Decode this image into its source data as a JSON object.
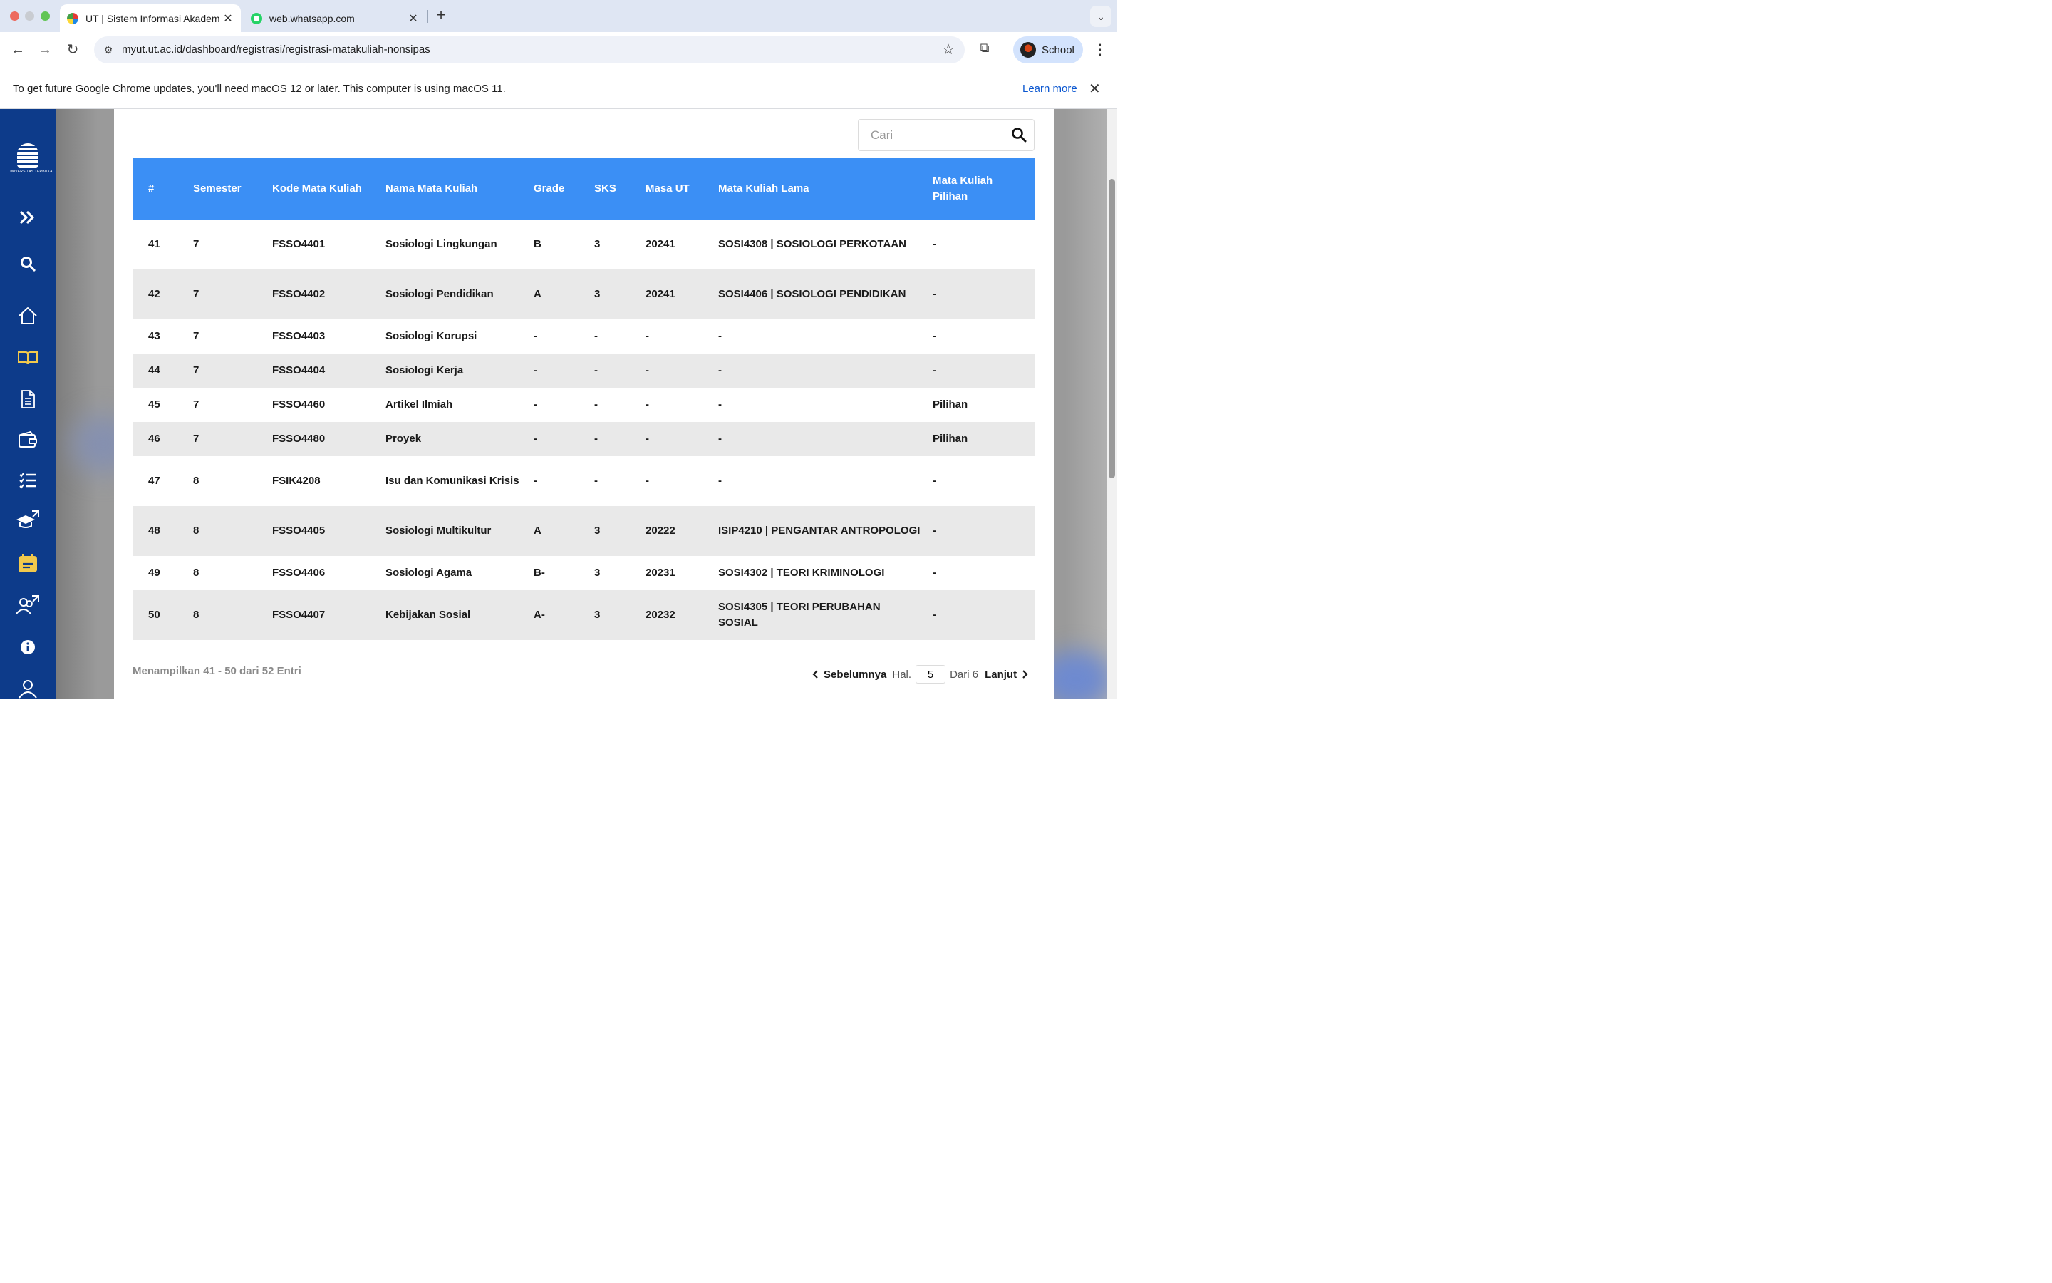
{
  "browser": {
    "tabs": [
      {
        "title": "UT | Sistem Informasi Akadem",
        "active": true
      },
      {
        "title": "web.whatsapp.com",
        "active": false
      }
    ],
    "url": "myut.ut.ac.id/dashboard/registrasi/registrasi-matakuliah-nonsipas",
    "profile_name": "School"
  },
  "infobar": {
    "message": "To get future Google Chrome updates, you'll need macOS 12 or later. This computer is using macOS 11.",
    "learn_more": "Learn more"
  },
  "sidebar": {
    "logo_text": "UNIVERSITAS TERBUKA",
    "icons": [
      "expand-icon",
      "search-icon",
      "home-icon",
      "book-icon",
      "document-icon",
      "wallet-icon",
      "checklist-icon",
      "graduation-external-icon",
      "calendar-icon",
      "users-external-icon",
      "info-icon",
      "user-icon"
    ]
  },
  "search": {
    "placeholder": "Cari",
    "value": ""
  },
  "table": {
    "headers": [
      "#",
      "Semester",
      "Kode Mata Kuliah",
      "Nama Mata Kuliah",
      "Grade",
      "SKS",
      "Masa UT",
      "Mata Kuliah Lama",
      "Mata Kuliah Pilihan"
    ],
    "rows": [
      {
        "no": "41",
        "semester": "7",
        "kode": "FSSO4401",
        "nama": "Sosiologi Lingkungan",
        "grade": "B",
        "sks": "3",
        "masa": "20241",
        "lama": "SOSI4308 | SOSIOLOGI PERKOTAAN",
        "pilihan": "-"
      },
      {
        "no": "42",
        "semester": "7",
        "kode": "FSSO4402",
        "nama": "Sosiologi Pendidikan",
        "grade": "A",
        "sks": "3",
        "masa": "20241",
        "lama": "SOSI4406 | SOSIOLOGI PENDIDIKAN",
        "pilihan": "-"
      },
      {
        "no": "43",
        "semester": "7",
        "kode": "FSSO4403",
        "nama": "Sosiologi Korupsi",
        "grade": "-",
        "sks": "-",
        "masa": "-",
        "lama": "-",
        "pilihan": "-"
      },
      {
        "no": "44",
        "semester": "7",
        "kode": "FSSO4404",
        "nama": "Sosiologi Kerja",
        "grade": "-",
        "sks": "-",
        "masa": "-",
        "lama": "-",
        "pilihan": "-"
      },
      {
        "no": "45",
        "semester": "7",
        "kode": "FSSO4460",
        "nama": "Artikel Ilmiah",
        "grade": "-",
        "sks": "-",
        "masa": "-",
        "lama": "-",
        "pilihan": "Pilihan"
      },
      {
        "no": "46",
        "semester": "7",
        "kode": "FSSO4480",
        "nama": "Proyek",
        "grade": "-",
        "sks": "-",
        "masa": "-",
        "lama": "-",
        "pilihan": "Pilihan"
      },
      {
        "no": "47",
        "semester": "8",
        "kode": "FSIK4208",
        "nama": "Isu dan Komunikasi Krisis",
        "grade": "-",
        "sks": "-",
        "masa": "-",
        "lama": "-",
        "pilihan": "-"
      },
      {
        "no": "48",
        "semester": "8",
        "kode": "FSSO4405",
        "nama": "Sosiologi Multikultur",
        "grade": "A",
        "sks": "3",
        "masa": "20222",
        "lama": "ISIP4210 | PENGANTAR ANTROPOLOGI",
        "pilihan": "-"
      },
      {
        "no": "49",
        "semester": "8",
        "kode": "FSSO4406",
        "nama": "Sosiologi Agama",
        "grade": "B-",
        "sks": "3",
        "masa": "20231",
        "lama": "SOSI4302 | TEORI KRIMINOLOGI",
        "pilihan": "-"
      },
      {
        "no": "50",
        "semester": "8",
        "kode": "FSSO4407",
        "nama": "Kebijakan Sosial",
        "grade": "A-",
        "sks": "3",
        "masa": "20232",
        "lama": "SOSI4305 | TEORI PERUBAHAN SOSIAL",
        "pilihan": "-"
      }
    ]
  },
  "pagination": {
    "summary": "Menampilkan 41 - 50 dari 52 Entri",
    "prev": "Sebelumnya",
    "hal": "Hal.",
    "page": "5",
    "dari": "Dari 6",
    "next": "Lanjut"
  },
  "colors": {
    "sidebar": "#0d3b8a",
    "table_header": "#3b8ff5",
    "row_stripe": "#e9e9e9",
    "accent_yellow": "#f2c94c"
  }
}
